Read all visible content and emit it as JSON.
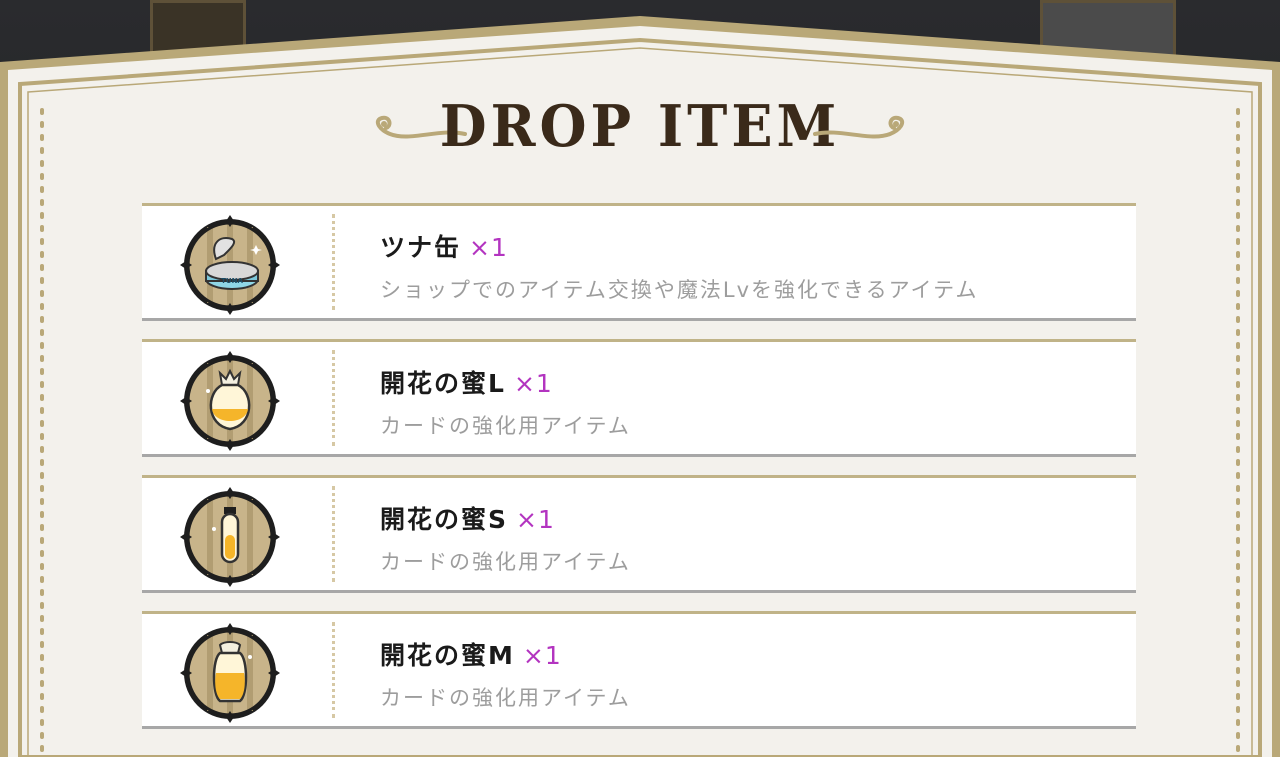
{
  "dialog": {
    "title": "DROP ITEM"
  },
  "items": [
    {
      "name": "ツナ缶",
      "qty": "×1",
      "desc": "ショップでのアイテム交換や魔法Lvを強化できるアイテム",
      "icon": "tuna-can-icon"
    },
    {
      "name": "開花の蜜L",
      "qty": "×1",
      "desc": "カードの強化用アイテム",
      "icon": "honey-large-icon"
    },
    {
      "name": "開花の蜜S",
      "qty": "×1",
      "desc": "カードの強化用アイテム",
      "icon": "honey-small-icon"
    },
    {
      "name": "開花の蜜M",
      "qty": "×1",
      "desc": "カードの強化用アイテム",
      "icon": "honey-medium-icon"
    }
  ],
  "colors": {
    "panel": "#f3f1ec",
    "gold": "#b9a878",
    "qty": "#b334c0",
    "desc": "#9d9d9d",
    "title": "#3a2a1a"
  }
}
